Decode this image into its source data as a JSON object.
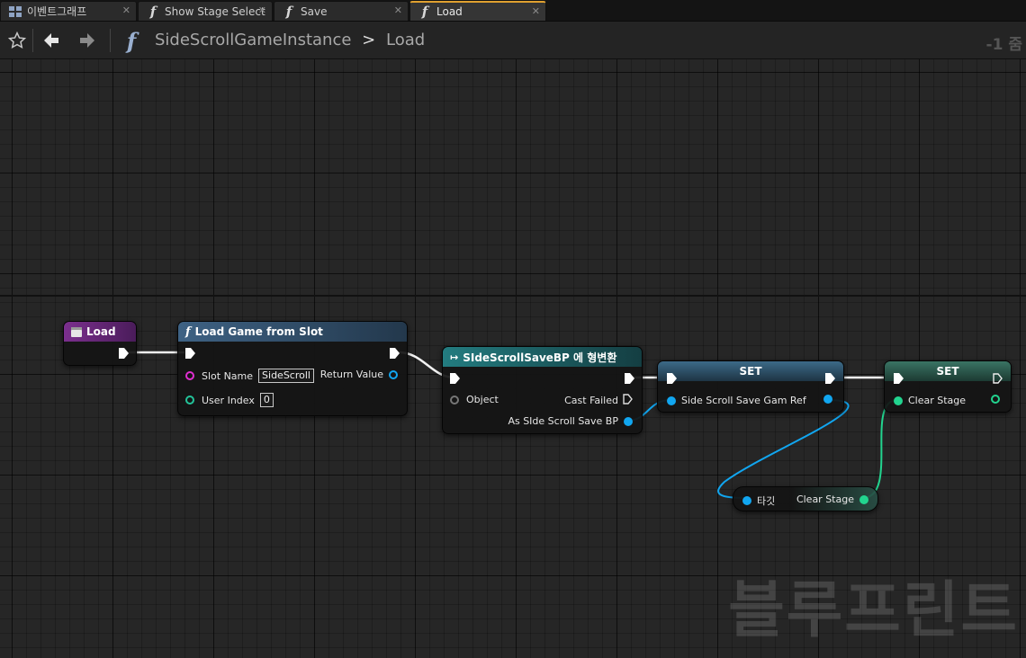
{
  "tabs": [
    {
      "label": "이벤트그래프",
      "icon": "event-graph-icon",
      "active": false
    },
    {
      "label": "Show Stage Select",
      "icon": "function-icon",
      "active": false
    },
    {
      "label": "Save",
      "icon": "function-icon",
      "active": false
    },
    {
      "label": "Load",
      "icon": "function-icon",
      "active": true
    }
  ],
  "toolbar": {
    "breadcrumb_class": "SideScrollGameInstance",
    "breadcrumb_separator": ">",
    "breadcrumb_function": "Load",
    "zoom": "-1 줌"
  },
  "nodes": {
    "entry": {
      "title": "Load"
    },
    "load_game": {
      "title": "Load Game from Slot",
      "slot_name_label": "Slot Name",
      "slot_name_value": "SideScroll",
      "user_index_label": "User Index",
      "user_index_value": "0",
      "return_label": "Return Value"
    },
    "cast": {
      "title": "SIdeScrollSaveBP 에 형변환",
      "object_label": "Object",
      "cast_failed_label": "Cast Failed",
      "as_label": "As SIde Scroll Save BP"
    },
    "set1": {
      "title": "SET",
      "pin_label": "Side Scroll Save Gam Ref"
    },
    "set2": {
      "title": "SET",
      "pin_label": "Clear Stage"
    },
    "getter": {
      "target_label": "타깃",
      "output_label": "Clear Stage"
    }
  },
  "colors": {
    "function_header": "#3b5a78",
    "event_header": "#6a2b7a",
    "cast_header": "#1f6a6e",
    "set_header": "#304858",
    "set2_header": "#2f5a4e",
    "object_pin": "#11a6f0",
    "bool_pin": "#22d48f",
    "string_pin": "#e02fd0",
    "int_pin": "#23c49a"
  },
  "watermark": "블루프린트"
}
